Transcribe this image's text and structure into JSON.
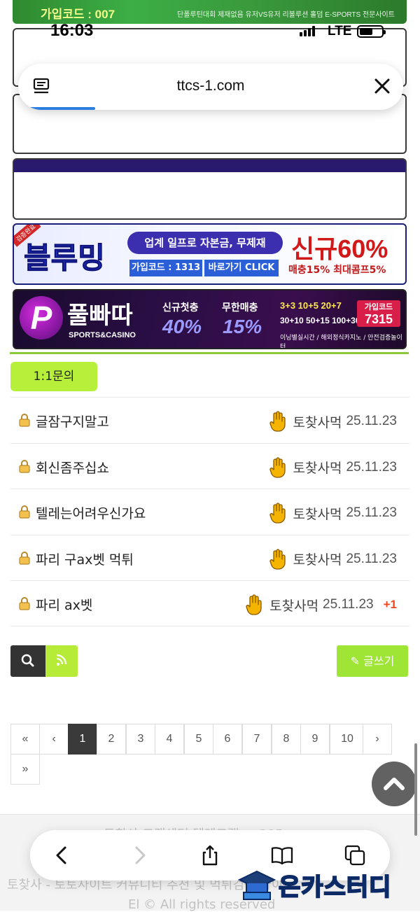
{
  "top_banner": {
    "code": "가입코드 : 007",
    "tagline": "단폴루틴대회 제재없음 유저VS유저 리볼루션 홀덤 E-SPORTS 전문사이트"
  },
  "status_bar": {
    "time": "16:03",
    "network": "LTE",
    "battery_level": 0.6
  },
  "browser": {
    "url": "ttcs-1.com",
    "load_progress": 0.2
  },
  "ads": {
    "bluming": {
      "ribbon": "검증완료",
      "brand": "블루밍",
      "headline": "업계 일프로 자본금, 무제재",
      "code": "가입코드 : 1313",
      "go": "바로가기 CLICK",
      "big": "신규60%",
      "small": "매충15% 최대콤프5%"
    },
    "poolbbadda": {
      "logo": "P",
      "brand": "풀빠따",
      "sub": "SPORTS&CASINO",
      "label1": "신규첫충",
      "label2": "무한매충",
      "pct1": "40%",
      "pct2": "15%",
      "bonus1": "3+3  10+5  20+7",
      "bonus2": "30+10 50+15 100+30",
      "join_label": "가입코드",
      "join_code": "7315",
      "foot": "이닝별실시간 / 해외정식카지노 / 안전검증놀이터"
    }
  },
  "section": {
    "label": "1:1문의"
  },
  "posts": [
    {
      "title": "글잠구지말고",
      "author": "토찾사먹",
      "date": "25.11.23",
      "count": ""
    },
    {
      "title": "회신좀주십쇼",
      "author": "토찾사먹",
      "date": "25.11.23",
      "count": ""
    },
    {
      "title": "텔레는어려우신가요",
      "author": "토찾사먹",
      "date": "25.11.23",
      "count": ""
    },
    {
      "title": "파리 구ax벳 먹튀",
      "author": "토찾사먹",
      "date": "25.11.23",
      "count": ""
    },
    {
      "title": "파리 ax벳",
      "author": "토찾사먹",
      "date": "25.11.23",
      "count": "+1"
    }
  ],
  "buttons": {
    "write": "글쓰기"
  },
  "pagination": {
    "first": "«",
    "prev": "‹",
    "next": "›",
    "last": "»",
    "pages": [
      "1",
      "2",
      "3",
      "4",
      "5",
      "6",
      "7",
      "8",
      "9",
      "10"
    ],
    "current": "1"
  },
  "footer": {
    "line1": "토찾사 고객센터 텔레그램 ... 295",
    "line2": "토찾사 - 토토사이트 커뮤니티 추천 및 먹튀검증 사이",
    "line3": "El © All rights reserved"
  },
  "watermark": {
    "text": "온카스터디"
  },
  "colors": {
    "accent_green": "#b6f03a",
    "progress_blue": "#2a7fe0",
    "count_red": "#f0461e"
  },
  "icons": [
    "reader-icon",
    "close-icon",
    "lock-icon",
    "hand-icon",
    "search-icon",
    "rss-icon",
    "pencil-icon",
    "chevron-up-icon",
    "back-icon",
    "forward-icon",
    "share-icon",
    "bookmarks-icon",
    "tabs-icon",
    "graduation-cap-icon"
  ]
}
